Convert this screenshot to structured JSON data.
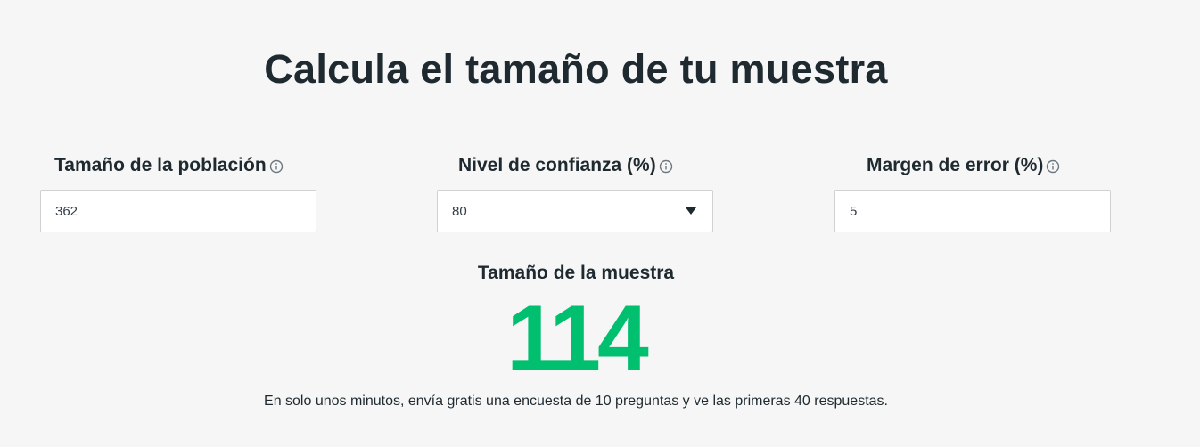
{
  "title": "Calcula el tamaño de tu muestra",
  "fields": {
    "population": {
      "label": "Tamaño de la población",
      "value": "362",
      "icon": "info-icon"
    },
    "confidence": {
      "label": "Nivel de confianza (%)",
      "selected": "80",
      "icon": "info-icon"
    },
    "margin": {
      "label": "Margen de error (%)",
      "value": "5",
      "icon": "info-icon"
    }
  },
  "result": {
    "label": "Tamaño de la muestra",
    "value": "114"
  },
  "promo": "En solo unos minutos, envía gratis una encuesta de 10 preguntas y ve las primeras 40 respuestas.",
  "colors": {
    "accent": "#00bf6f",
    "text": "#1e2a30",
    "background": "#f6f6f6"
  }
}
